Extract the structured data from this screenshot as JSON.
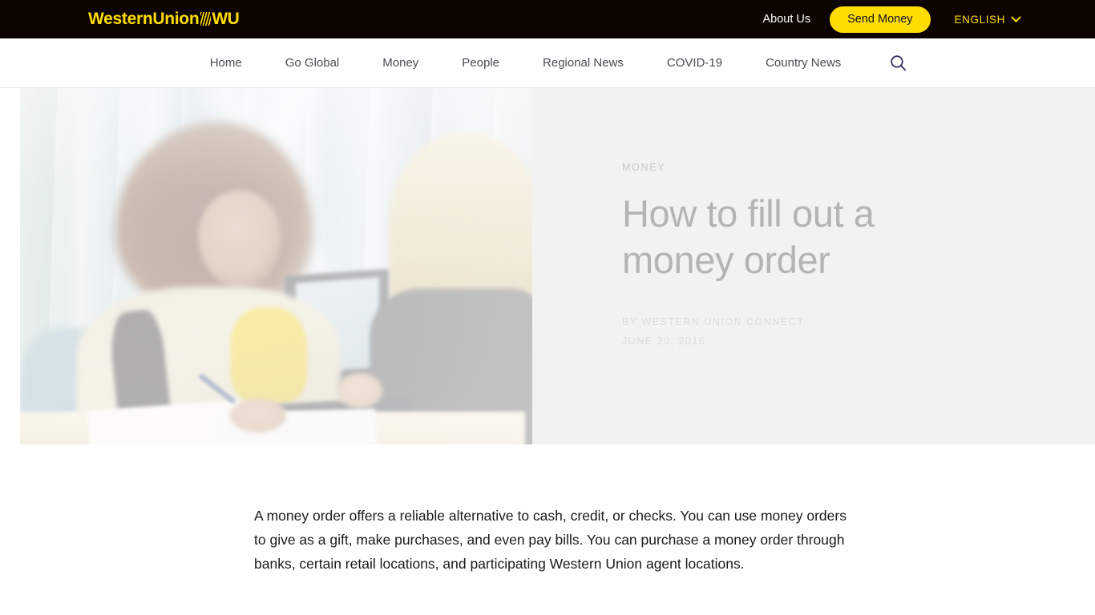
{
  "brand": {
    "logo_word": "WesternUnion",
    "logo_mark": "WU",
    "logo_color": "#ffdd00",
    "topbar_bg": "#0d0400"
  },
  "topbar": {
    "about_label": "About Us",
    "send_money_label": "Send Money",
    "send_money_bg": "#ffdd00",
    "language_label": "ENGLISH",
    "language_chevron_icon": "chevron-down-icon"
  },
  "mainnav": {
    "items": [
      {
        "label": "Home"
      },
      {
        "label": "Go Global"
      },
      {
        "label": "Money"
      },
      {
        "label": "People"
      },
      {
        "label": "Regional News"
      },
      {
        "label": "COVID-19"
      },
      {
        "label": "Country News"
      }
    ],
    "search_icon": "search-icon",
    "search_icon_color": "#313166",
    "text_color": "#4a4a52"
  },
  "hero": {
    "panel_bg": "#f2f2f2",
    "photo_alt": "Woman filling out a form at a Western Union agent counter while an agent assists at a computer",
    "eyebrow": "MONEY",
    "title": "How to fill out a money order",
    "byline_author": "BY WESTERN UNION CONNECT",
    "byline_date": "JUNE 20, 2016",
    "title_color": "#b4b4b4"
  },
  "article": {
    "paragraph": "A money order offers a reliable alternative to cash, credit, or checks. You can use money orders to give as a gift, make purchases, and even pay bills. You can purchase a money order through banks, certain retail locations, and participating Western Union agent locations."
  }
}
